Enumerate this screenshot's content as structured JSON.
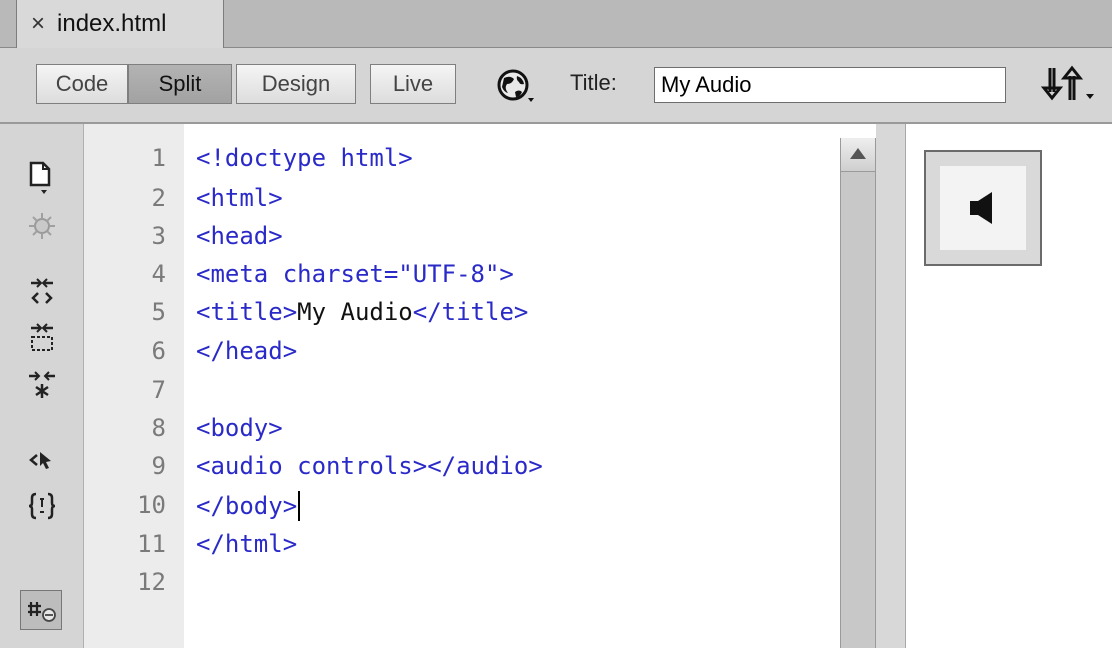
{
  "tab": {
    "close_symbol": "×",
    "label": "index.html"
  },
  "toolbar": {
    "views": [
      {
        "label": "Code",
        "active": false
      },
      {
        "label": "Split",
        "active": true
      },
      {
        "label": "Design",
        "active": false
      },
      {
        "label": "Live",
        "active": false
      }
    ],
    "title_label": "Title:",
    "title_value": "My Audio",
    "icons": [
      "globe-icon",
      "file-management-icon"
    ]
  },
  "left_tools": [
    "open-documents-icon",
    "debug-icon",
    "collapse-full-tag-icon",
    "collapse-selection-icon",
    "expand-all-icon",
    "select-parent-tag-icon",
    "balance-braces-icon",
    "line-numbers-icon"
  ],
  "editor": {
    "line_numbers": [
      "1",
      "2",
      "3",
      "4",
      "5",
      "6",
      "7",
      "8",
      "9",
      "10",
      "11",
      "12"
    ],
    "lines": [
      {
        "tag": "<!doctype html>"
      },
      {
        "tag": "<html>"
      },
      {
        "tag": "<head>"
      },
      {
        "tag": "<meta charset=\"UTF-8\">"
      },
      {
        "tag": "<title>",
        "text": "My Audio",
        "tag_end": "</title>"
      },
      {
        "tag": "</head>"
      },
      {
        "tag": ""
      },
      {
        "tag": "<body>"
      },
      {
        "tag": "<audio controls></audio>"
      },
      {
        "tag": "</body>"
      },
      {
        "tag": "</html>"
      },
      {
        "tag": ""
      }
    ],
    "cursor_line": 10
  },
  "design_view": {
    "element": "audio-placeholder",
    "icon": "speaker-icon"
  },
  "colors": {
    "tag": "#2a2ac8",
    "text": "#111111",
    "line_number": "#7a7a7a"
  }
}
